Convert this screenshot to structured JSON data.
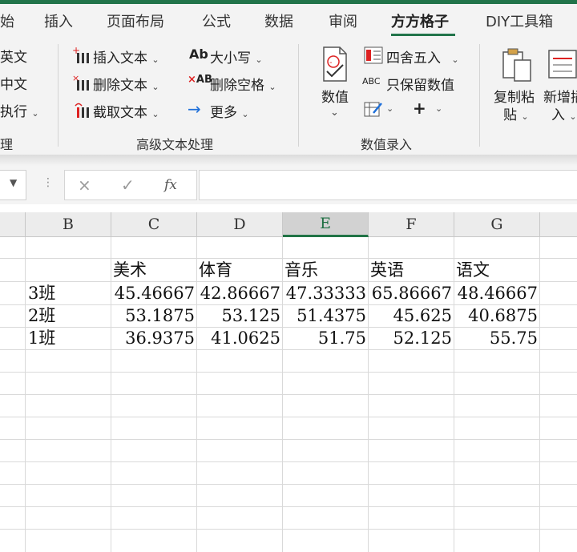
{
  "tabs": [
    "始",
    "插入",
    "页面布局",
    "公式",
    "数据",
    "审阅",
    "方方格子",
    "DIY工具箱"
  ],
  "active_tab": "方方格子",
  "ribbon": {
    "left_items": [
      "英文",
      "中文",
      "执行"
    ],
    "left_group_label": "理",
    "text_group": {
      "insert_text": "插入文本",
      "delete_text": "删除文本",
      "extract_text": "截取文本",
      "case": "大小写",
      "delete_space": "删除空格",
      "more": "更多",
      "label": "高级文本处理"
    },
    "value_group": {
      "value_button": "数值",
      "round": "四舍五入",
      "keep_numbers": "只保留数值",
      "label": "数值录入"
    },
    "copy_paste": [
      "复制粘",
      "贴"
    ],
    "new_insert": [
      "新增插",
      "入"
    ],
    "case_icon_text": "Ab",
    "delete_space_icon_text": "AB",
    "keep_numbers_icon_text": "ABC"
  },
  "formula_bar": {
    "cancel_glyph": "×",
    "enter_glyph": "✓",
    "fx_glyph": "fx",
    "value": ""
  },
  "columns": [
    "B",
    "C",
    "D",
    "E",
    "F",
    "G"
  ],
  "selected_column": "E",
  "headers": [
    "美术",
    "体育",
    "音乐",
    "英语",
    "语文"
  ],
  "rows": [
    {
      "label": "3班",
      "values": [
        "45.46667",
        "42.86667",
        "47.33333",
        "65.86667",
        "48.46667"
      ]
    },
    {
      "label": "2班",
      "values": [
        "53.1875",
        "53.125",
        "51.4375",
        "45.625",
        "40.6875"
      ]
    },
    {
      "label": "1班",
      "values": [
        "36.9375",
        "41.0625",
        "51.75",
        "52.125",
        "55.75"
      ]
    }
  ],
  "colors": {
    "accent": "#217346",
    "ribbon_bg": "#f3f3f3",
    "grid": "#d9d9d9"
  }
}
